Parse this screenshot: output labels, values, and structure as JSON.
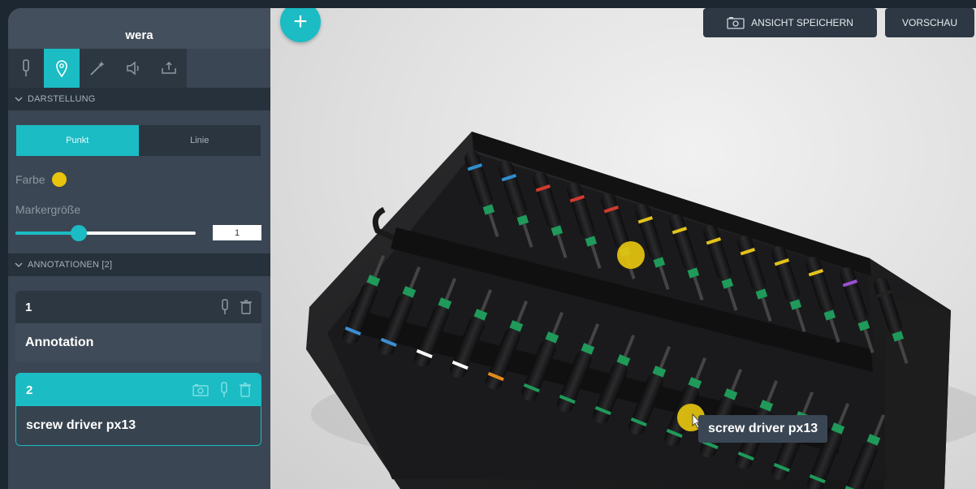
{
  "panel": {
    "title": "wera",
    "tools": [
      "pin-tool-icon",
      "marker-tool-icon",
      "magic-wand-icon",
      "speaker-icon",
      "export-icon"
    ],
    "active_tool_index": 1
  },
  "darstellung": {
    "header": "DARSTELLUNG",
    "segments": [
      "Punkt",
      "Linie"
    ],
    "selected_segment": "Punkt",
    "farbe_label": "Farbe",
    "farbe_color": "#e8c40e",
    "markergroesse_label": "Markergröße",
    "markergroesse_value": "1",
    "slider_fraction": 0.35
  },
  "annotationen": {
    "header": "ANNOTATIONEN [2]",
    "items": [
      {
        "number": "1",
        "text": "Annotation",
        "selected": false
      },
      {
        "number": "2",
        "text": "screw driver px13",
        "selected": true
      }
    ]
  },
  "viewport": {
    "add_label": "+",
    "save_view_label": "ANSICHT SPEICHERN",
    "preview_label": "VORSCHAU",
    "tooltip_text": "screw driver px13",
    "accent": "#1bbcc4",
    "marker_color": "#e8c40e"
  }
}
